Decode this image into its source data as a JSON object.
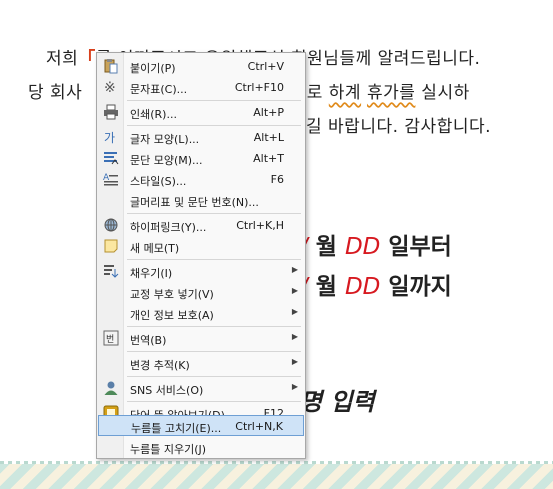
{
  "document": {
    "line1_pre": "저희",
    "line1_mark": "「",
    "line1_rest": "를 이꺼주시고 유원해주신 회원님들께 알려드립니다.",
    "line2_pre": "당 회사",
    "line2_mid": "일정으로 ",
    "line2_sq1": "하계",
    "line2_sp": " ",
    "line2_sq2": "휴가를",
    "line2_post": " 실시하",
    "line3": "길 바랍니다. 감사합니다.",
    "date1_mm": "/",
    "date1_month": " 월  ",
    "date1_dd": "DD",
    "date1_suffix": " 일부터",
    "date2_mm": "/",
    "date2_month": " 월  ",
    "date2_dd": "DD",
    "date2_suffix": " 일까지",
    "company_placeholder": "명  입력"
  },
  "context_menu": {
    "items": [
      {
        "label": "붙이기(P)",
        "shortcut": "Ctrl+V",
        "icon": "paste-icon"
      },
      {
        "label": "문자표(C)...",
        "shortcut": "Ctrl+F10",
        "icon": "symbol-icon"
      },
      {
        "label": "인쇄(R)...",
        "shortcut": "Alt+P",
        "icon": "print-icon"
      },
      {
        "label": "글자 모양(L)...",
        "shortcut": "Alt+L",
        "icon": "char-shape-icon"
      },
      {
        "label": "문단 모양(M)...",
        "shortcut": "Alt+T",
        "icon": "paragraph-shape-icon"
      },
      {
        "label": "스타일(S)...",
        "shortcut": "F6",
        "icon": "style-icon"
      },
      {
        "label": "글머리표 및 문단 번호(N)...",
        "shortcut": "",
        "icon": ""
      },
      {
        "label": "하이퍼링크(Y)...",
        "shortcut": "Ctrl+K,H",
        "icon": "hyperlink-icon"
      },
      {
        "label": "새 메모(T)",
        "shortcut": "",
        "icon": "memo-icon"
      },
      {
        "label": "채우기(I)",
        "shortcut": "",
        "icon": "fill-icon",
        "submenu": true
      },
      {
        "label": "교정 부호 넣기(V)",
        "shortcut": "",
        "icon": "",
        "submenu": true
      },
      {
        "label": "개인 정보 보호(A)",
        "shortcut": "",
        "icon": "",
        "submenu": true
      },
      {
        "label": "번역(B)",
        "shortcut": "",
        "icon": "translate-icon",
        "submenu": true
      },
      {
        "label": "변경 추적(K)",
        "shortcut": "",
        "icon": "",
        "submenu": true
      },
      {
        "label": "SNS 서비스(O)",
        "shortcut": "",
        "icon": "sns-icon",
        "submenu": true
      },
      {
        "label": "단어 뜻 알아보기(D)...",
        "shortcut": "F12",
        "icon": "dictionary-icon"
      },
      {
        "label": "누름틀 고치기(E)...",
        "shortcut": "Ctrl+N,K",
        "icon": "",
        "highlighted": true
      },
      {
        "label": "누름틀 지우기(J)",
        "shortcut": "",
        "icon": ""
      }
    ],
    "submenu_arrow": "▶"
  },
  "colors": {
    "highlight_bg": "#cfe3f7",
    "highlight_border": "#6e9fd4",
    "red_text": "#d71920"
  }
}
